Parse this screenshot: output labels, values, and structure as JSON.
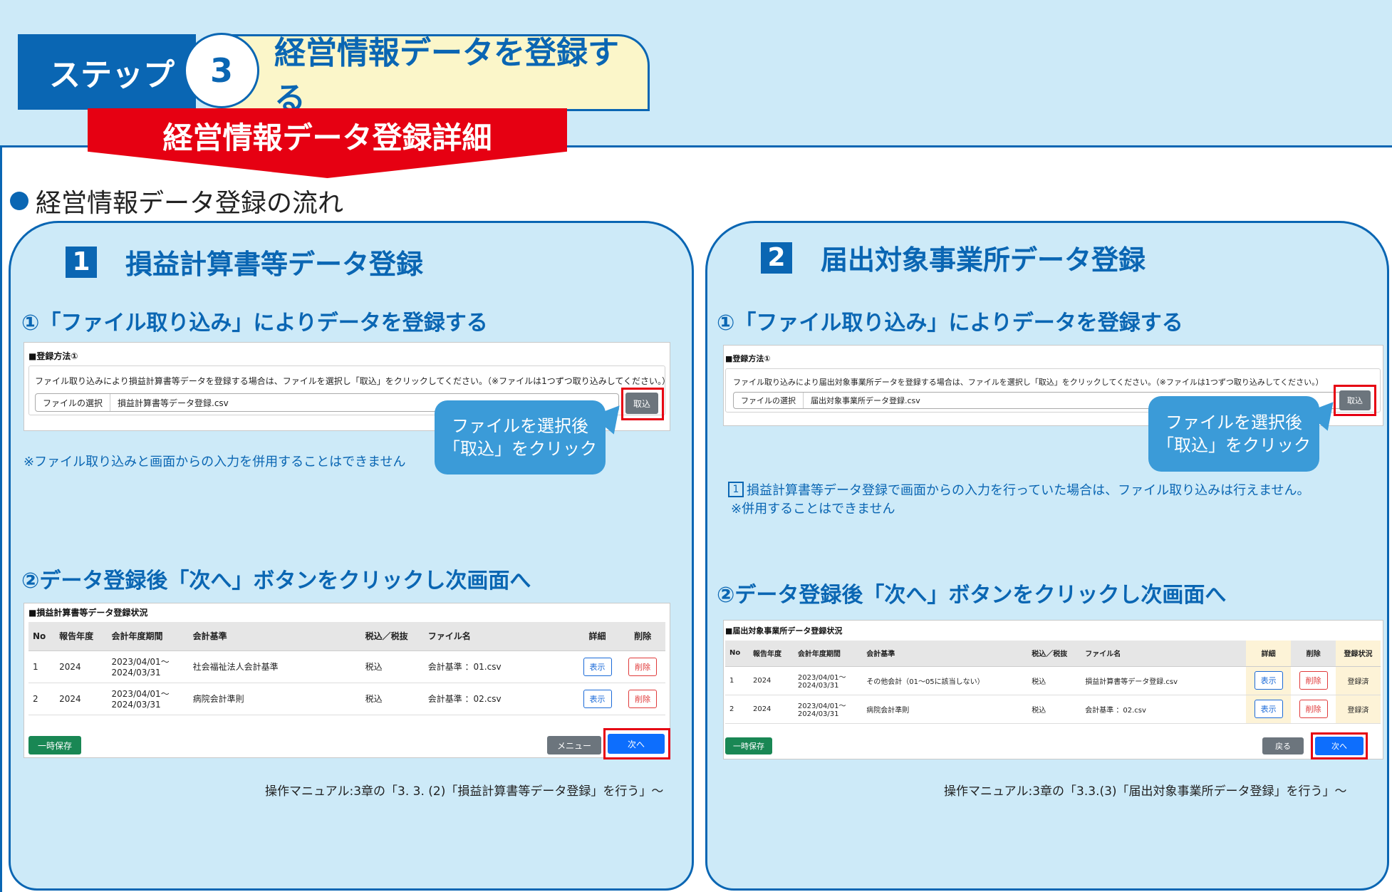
{
  "header": {
    "step_label": "ステップ",
    "step_number": "3",
    "title": "経営情報データを登録する",
    "ribbon": "経営情報データ登録詳細"
  },
  "flow_heading": "経営情報データ登録の流れ",
  "panel1": {
    "number": "1",
    "title": "損益計算書等データ登録",
    "sub1": "①「ファイル取り込み」によりデータを登録する",
    "shot1": {
      "section": "■登録方法①",
      "instruction": "ファイル取り込みにより損益計算書等データを登録する場合は、ファイルを選択し「取込」をクリックしてください。（※ファイルは1つずつ取り込みしてください。）",
      "file_label": "ファイルの選択",
      "file_value": "損益計算書等データ登録.csv",
      "import_button": "取込"
    },
    "callout": [
      "ファイルを選択後",
      "「取込」をクリック"
    ],
    "note": "※ファイル取り込みと画面からの入力を併用することはできません",
    "sub2": "②データ登録後「次へ」ボタンをクリックし次画面へ",
    "shot2": {
      "section": "■損益計算書等データ登録状況",
      "columns": [
        "No",
        "報告年度",
        "会計年度期間",
        "会計基準",
        "税込／税抜",
        "ファイル名",
        "詳細",
        "削除"
      ],
      "rows": [
        {
          "no": "1",
          "year": "2024",
          "period1": "2023/04/01～",
          "period2": "2024/03/31",
          "standard": "社会福祉法人会計基準",
          "tax": "税込",
          "file": "会計基準 ：01.csv",
          "show": "表示",
          "del": "削除"
        },
        {
          "no": "2",
          "year": "2024",
          "period1": "2023/04/01～",
          "period2": "2024/03/31",
          "standard": "病院会計準則",
          "tax": "税込",
          "file": "会計基準 ：02.csv",
          "show": "表示",
          "del": "削除"
        }
      ],
      "save_button": "一時保存",
      "menu_button": "メニュー",
      "next_button": "次へ"
    },
    "manual_ref": "操作マニュアル:3章の「3. 3. (2)「損益計算書等データ登録」を行う」～"
  },
  "panel2": {
    "number": "2",
    "title": "届出対象事業所データ登録",
    "sub1": "①「ファイル取り込み」によりデータを登録する",
    "shot1": {
      "section": "■登録方法①",
      "instruction": "ファイル取り込みにより届出対象事業所データを登録する場合は、ファイルを選択し「取込」をクリックしてください。（※ファイルは1つずつ取り込みしてください。）",
      "file_label": "ファイルの選択",
      "file_value": "届出対象事業所データ登録.csv",
      "import_button": "取込"
    },
    "callout": [
      "ファイルを選択後",
      "「取込」をクリック"
    ],
    "note_badge": "1",
    "note_line1": "損益計算書等データ登録で画面からの入力を行っていた場合は、ファイル取り込みは行えません。",
    "note_line2": "※併用することはできません",
    "sub2": "②データ登録後「次へ」ボタンをクリックし次画面へ",
    "shot2": {
      "section": "■届出対象事業所データ登録状況",
      "columns": [
        "No",
        "報告年度",
        "会計年度期間",
        "会計基準",
        "税込／税抜",
        "ファイル名",
        "詳細",
        "削除",
        "登録状況"
      ],
      "rows": [
        {
          "no": "1",
          "year": "2024",
          "period1": "2023/04/01～",
          "period2": "2024/03/31",
          "standard": "その他会計（01～05に該当しない）",
          "tax": "税込",
          "file": "損益計算書等データ登録.csv",
          "show": "表示",
          "del": "削除",
          "status": "登録済"
        },
        {
          "no": "2",
          "year": "2024",
          "period1": "2023/04/01～",
          "period2": "2024/03/31",
          "standard": "病院会計準則",
          "tax": "税込",
          "file": "会計基準 ：02.csv",
          "show": "表示",
          "del": "削除",
          "status": "登録済"
        }
      ],
      "save_button": "一時保存",
      "back_button": "戻る",
      "next_button": "次へ"
    },
    "manual_ref": "操作マニュアル:3章の「3.3.(3)「届出対象事業所データ登録」を行う」～"
  },
  "colors": {
    "brand_blue": "#0a66b3",
    "ribbon_red": "#e60012",
    "panel_bg": "#cdeaf8",
    "title_bg": "#fbf6c9",
    "callout_blue": "#3b9bd8"
  }
}
